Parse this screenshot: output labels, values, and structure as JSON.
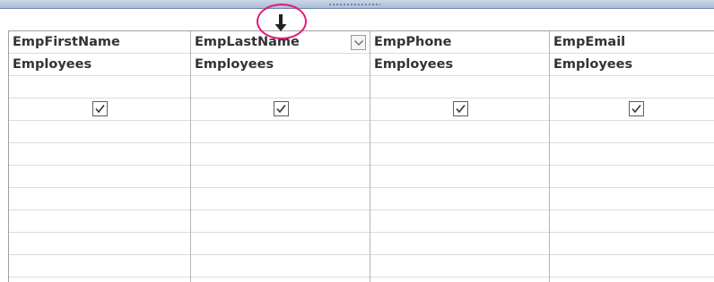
{
  "query_grid": {
    "columns": [
      {
        "field": "EmpFirstName",
        "table": "Employees",
        "show": true
      },
      {
        "field": "EmpLastName",
        "table": "Employees",
        "show": true,
        "has_dropdown": true
      },
      {
        "field": "EmpPhone",
        "table": "Employees",
        "show": true
      },
      {
        "field": "EmpEmail",
        "table": "Employees",
        "show": true
      }
    ]
  },
  "highlight": {
    "color": "#e01a78",
    "icon": "move-down-arrow-icon"
  }
}
